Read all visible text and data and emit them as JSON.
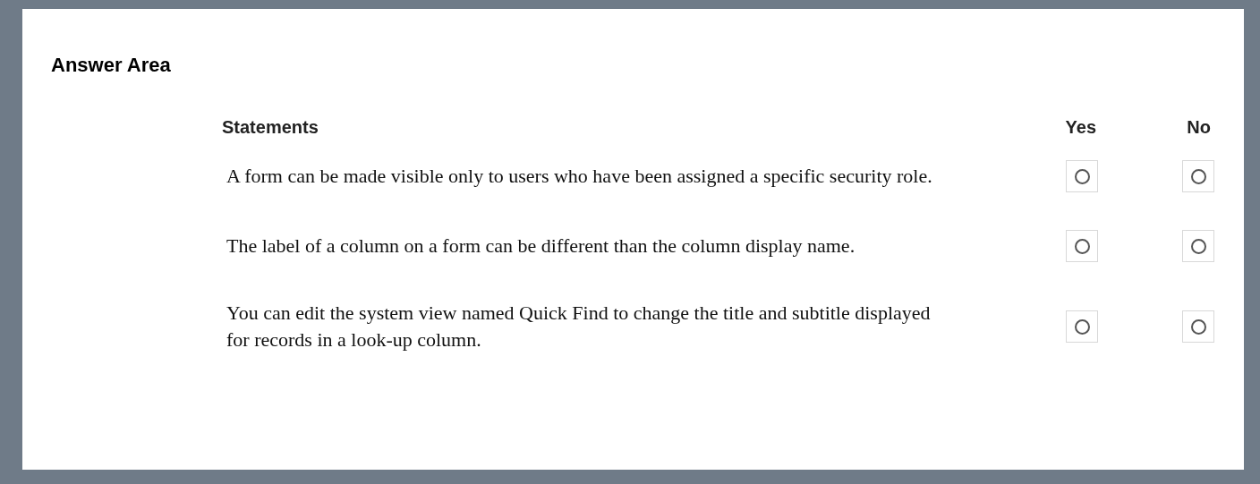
{
  "title": "Answer Area",
  "columns": {
    "statement": "Statements",
    "yes": "Yes",
    "no": "No"
  },
  "rows": [
    {
      "text": "A form can be made visible only to users who have been assigned a specific security role.",
      "yes_selected": false,
      "no_selected": false
    },
    {
      "text": "The label of a column on a form can be different than the column display name.",
      "yes_selected": false,
      "no_selected": false
    },
    {
      "text": "You can edit the system view named Quick Find to change the title and subtitle displayed for records in a look-up column.",
      "yes_selected": false,
      "no_selected": false
    }
  ]
}
